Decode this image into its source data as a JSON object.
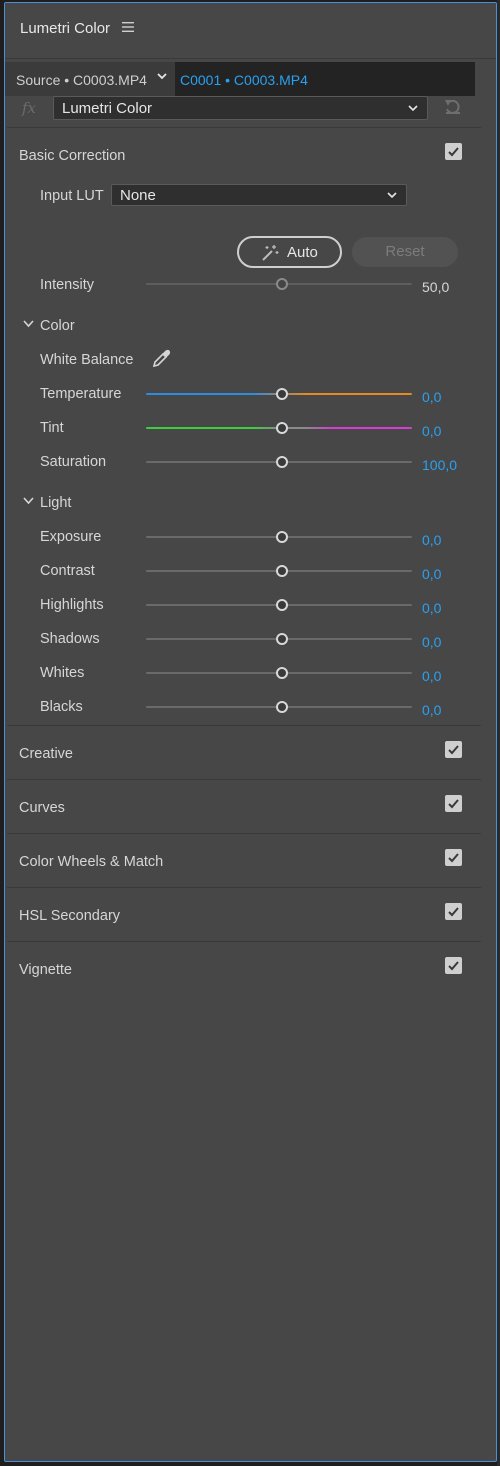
{
  "panel": {
    "title": "Lumetri Color"
  },
  "source": {
    "label": "Source • C0003.MP4",
    "clip": "C0001 • C0003.MP4"
  },
  "effect": {
    "fx_symbol": "fx",
    "name": "Lumetri Color"
  },
  "basic": {
    "title": "Basic Correction",
    "enabled": true,
    "input_lut_label": "Input LUT",
    "input_lut_value": "None",
    "auto_label": "Auto",
    "reset_label": "Reset",
    "intensity_label": "Intensity",
    "intensity_value": "50,0",
    "color": {
      "title": "Color",
      "white_balance_label": "White Balance",
      "sliders": [
        {
          "label": "Temperature",
          "value": "0,0"
        },
        {
          "label": "Tint",
          "value": "0,0"
        },
        {
          "label": "Saturation",
          "value": "100,0"
        }
      ]
    },
    "light": {
      "title": "Light",
      "sliders": [
        {
          "label": "Exposure",
          "value": "0,0"
        },
        {
          "label": "Contrast",
          "value": "0,0"
        },
        {
          "label": "Highlights",
          "value": "0,0"
        },
        {
          "label": "Shadows",
          "value": "0,0"
        },
        {
          "label": "Whites",
          "value": "0,0"
        },
        {
          "label": "Blacks",
          "value": "0,0"
        }
      ]
    }
  },
  "sections": [
    {
      "title": "Creative",
      "enabled": true
    },
    {
      "title": "Curves",
      "enabled": true
    },
    {
      "title": "Color Wheels & Match",
      "enabled": true
    },
    {
      "title": "HSL Secondary",
      "enabled": true
    },
    {
      "title": "Vignette",
      "enabled": true
    }
  ],
  "colors": {
    "accent": "#2aa0f0",
    "panel_bg": "#474747",
    "temperature_left": "#2d8be0",
    "temperature_right": "#e38a22",
    "tint_left": "#3ccf3c",
    "tint_right": "#d63cd6"
  },
  "icons": {
    "menu": "hamburger-icon",
    "dropdown": "chevron-down-icon",
    "reset": "undo-icon",
    "wand": "magic-wand-icon",
    "eyedropper": "eyedropper-icon",
    "checkbox": "checkmark-icon"
  }
}
